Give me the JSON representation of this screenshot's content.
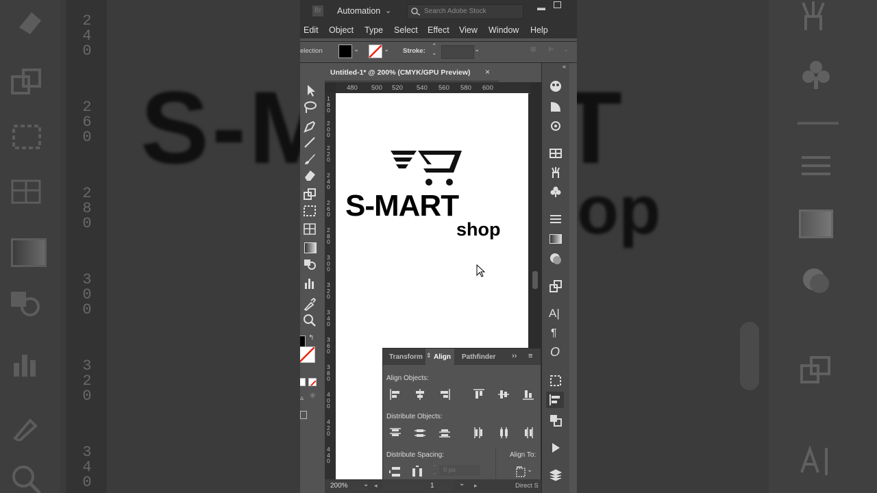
{
  "app": {
    "workspace": "Automation",
    "search_placeholder": "Search Adobe Stock",
    "menu": [
      "Edit",
      "Object",
      "Type",
      "Select",
      "Effect",
      "View",
      "Window",
      "Help"
    ],
    "control": {
      "tool_label": "election",
      "stroke_label": "Stroke:"
    },
    "doc_tab": "Untitled-1* @ 200% (CMYK/GPU Preview)",
    "h_ruler": [
      "480",
      "500",
      "520",
      "540",
      "560",
      "580",
      "600"
    ],
    "v_ruler": [
      "1\n8\n0",
      "2\n0\n0",
      "2\n2\n0",
      "2\n4\n0",
      "2\n6\n0",
      "2\n8\n0",
      "3\n0\n0",
      "3\n2\n0",
      "3\n4\n0",
      "3\n6\n0",
      "3\n8\n0",
      "4\n0\n0",
      "4\n2\n0",
      "4\n4\n0"
    ],
    "logo": {
      "brand": "S-MART",
      "sub": "shop"
    },
    "align_panel": {
      "tabs": [
        "Transform",
        "Align",
        "Pathfinder"
      ],
      "active_tab": "Align",
      "align_objects": "Align Objects:",
      "distribute_objects": "Distribute Objects:",
      "distribute_spacing": "Distribute Spacing:",
      "align_to": "Align To:",
      "spacing_value": "0 px"
    },
    "status": {
      "zoom": "200%",
      "artboard": "1",
      "tool": "Direct S"
    }
  },
  "background": {
    "big_text_top": "S-MART",
    "big_text_bottom": "op",
    "left_ruler": [
      "2\n4\n0",
      "2\n6\n0",
      "2\n8\n0",
      "3\n0\n0",
      "3\n2\n0",
      "3\n4\n0"
    ]
  }
}
